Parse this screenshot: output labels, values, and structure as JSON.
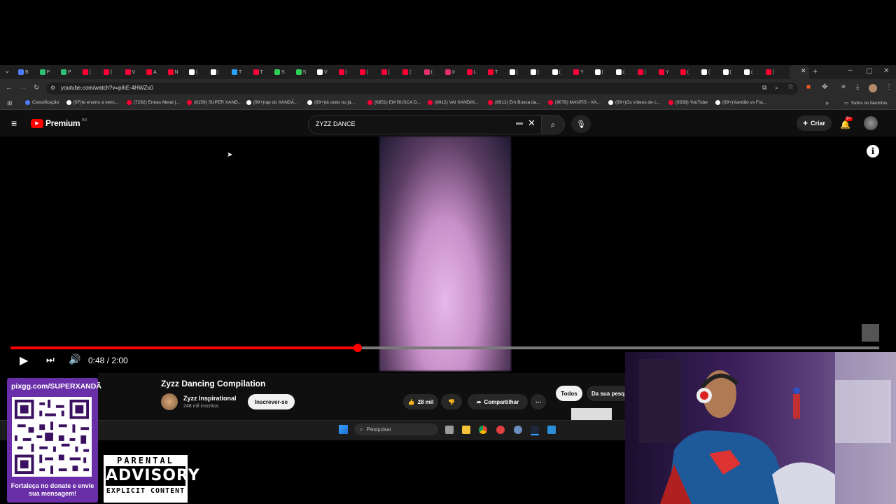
{
  "browser": {
    "url": "youtube.com/watch?v=pihE-4HWZx0",
    "tabs": [
      {
        "label": "B",
        "color": "#4f7cff"
      },
      {
        "label": "P",
        "color": "#2fbf71"
      },
      {
        "label": "P",
        "color": "#2fbf71"
      },
      {
        "label": "(",
        "color": "#ff0033"
      },
      {
        "label": "(",
        "color": "#ff0033"
      },
      {
        "label": "V",
        "color": "#ff0033"
      },
      {
        "label": "A",
        "color": "#ff0033"
      },
      {
        "label": "N",
        "color": "#ff0033"
      },
      {
        "label": "(",
        "color": "#ffffff"
      },
      {
        "label": "(",
        "color": "#ffffff"
      },
      {
        "label": "T",
        "color": "#2aa3ff"
      },
      {
        "label": "T",
        "color": "#ff0033"
      },
      {
        "label": "S",
        "color": "#2fd058"
      },
      {
        "label": "S",
        "color": "#2fd058"
      },
      {
        "label": "V",
        "color": "#ffffff"
      },
      {
        "label": "(",
        "color": "#ff0033"
      },
      {
        "label": "(",
        "color": "#ff0033"
      },
      {
        "label": "(",
        "color": "#ff0033"
      },
      {
        "label": "(",
        "color": "#ff0033"
      },
      {
        "label": "(",
        "color": "#e1306c"
      },
      {
        "label": "Ir",
        "color": "#e1306c"
      },
      {
        "label": "L",
        "color": "#ff0033"
      },
      {
        "label": "T",
        "color": "#ff0033"
      },
      {
        "label": "(",
        "color": "#ffffff"
      },
      {
        "label": "(",
        "color": "#ffffff"
      },
      {
        "label": "(",
        "color": "#ffffff"
      },
      {
        "label": "Y",
        "color": "#ff0033"
      },
      {
        "label": "(",
        "color": "#ffffff"
      },
      {
        "label": "(",
        "color": "#ffffff"
      },
      {
        "label": "(",
        "color": "#ff0033"
      },
      {
        "label": "Y",
        "color": "#ff0033"
      },
      {
        "label": "(",
        "color": "#ff0033"
      },
      {
        "label": "(",
        "color": "#ffffff"
      },
      {
        "label": "(",
        "color": "#ffffff"
      },
      {
        "label": "(",
        "color": "#ffffff"
      },
      {
        "label": "(",
        "color": "#ff0033"
      }
    ],
    "bookmarks": [
      {
        "label": "Classificação",
        "color": "#4f7cff"
      },
      {
        "label": "(97)Ie ensino a venc...",
        "color": "#ffffff"
      },
      {
        "label": "(7292) Enéas Metal |...",
        "color": "#ff0033"
      },
      {
        "label": "(8159) SUPER XAND...",
        "color": "#ff0033"
      },
      {
        "label": "(99+)rap do XANDÃ...",
        "color": "#ffffff"
      },
      {
        "label": "(99+)tá cedo ou já...",
        "color": "#ffffff"
      },
      {
        "label": "(6851) EM BUSCA D...",
        "color": "#ff0033"
      },
      {
        "label": "(8912) VAI XANDIN...",
        "color": "#ff0033"
      },
      {
        "label": "(8912) Em Busca da...",
        "color": "#ff0033"
      },
      {
        "label": "(9078) MANTIS - XA...",
        "color": "#ff0033"
      },
      {
        "label": "(99+)Os vídeos de c...",
        "color": "#ffffff"
      },
      {
        "label": "(9338) YouTube",
        "color": "#ff0033"
      },
      {
        "label": "(99+)Xandão vs Fra...",
        "color": "#ffffff"
      }
    ],
    "all_bookmarks": "Todos os favoritos"
  },
  "youtube": {
    "logo": "Premium",
    "region": "BR",
    "search_value": "ZYZZ DANCE",
    "create_label": "Criar",
    "notifications": "9+",
    "player": {
      "time": "0:48 / 2:00",
      "progress": 0.4
    },
    "video": {
      "title": "Zyzz Dancing Compilation",
      "channel": "Zyzz Inspirational",
      "subscribers": "248 mil inscritos",
      "subscribe_label": "Inscrever-se",
      "likes": "28 mil",
      "share_label": "Compartilhar"
    },
    "chips": [
      "Todos",
      "Da sua pesq"
    ]
  },
  "taskbar": {
    "search_placeholder": "Pesquisar"
  },
  "overlay": {
    "qr_url": "pixgg.com/SUPERXANDÃ",
    "qr_text": "Fortaleça no donate e envie sua mensagem!",
    "advisory": [
      "PARENTAL",
      "ADVISORY",
      "EXPLICIT CONTENT"
    ]
  }
}
